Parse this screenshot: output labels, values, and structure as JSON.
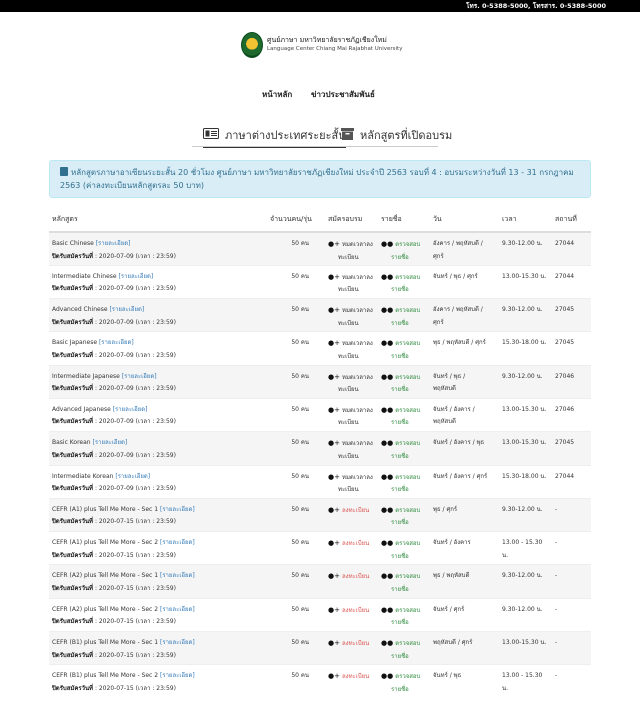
{
  "topbar": {
    "phones": "โทร. 0-5388-5000, โทรสาร. 0-5388-5000"
  },
  "logo": {
    "th": "ศูนย์ภาษา มหาวิทยาลัยราชภัฏเชียงใหม่",
    "en": "Language Center Chiang Mai Rajabhat University"
  },
  "nav": {
    "home": "หน้าหลัก",
    "news": "ข่าวประชาสัมพันธ์"
  },
  "tabs": {
    "short_courses": "ภาษาต่างประเทศระยะสั้น",
    "open_courses": "หลักสูตรที่เปิดอบรม"
  },
  "info": {
    "text": "หลักสูตรภาษาอาเซียนระยะสั้น 20 ชั่วโมง ศูนย์ภาษา มหาวิทยาลัยราชภัฏเชียงใหม่ ประจำปี 2563 รอบที่ 4 : อบรมระหว่างวันที่ 13 - 31 กรกฎาคม 2563 (ค่าลงทะเบียนหลักสูตรละ 50 บาท)"
  },
  "table": {
    "headers": {
      "course": "หลักสูตร",
      "quota": "จำนวนคน/รุ่น",
      "apply": "สมัครอบรม",
      "list": "รายชื่อ",
      "day": "วัน",
      "time": "เวลา",
      "room": "สถานที่"
    },
    "detail_label": "[รายละเอียด]",
    "close_label": "ปิดรับสมัครวันที่",
    "check_label": "ตรวจสอบ",
    "list_label": "รายชื่อ",
    "rows": [
      {
        "name": "Basic Chinese",
        "close": ": 2020-07-09 (เวลา : 23:59)",
        "quota": "50 คน",
        "reg1": "หมดเวลาลง",
        "reg2": "ทะเบียน",
        "day1": "อังคาร / พฤหัสบดี /",
        "day2": "ศุกร์",
        "time": "9.30-12.00 น.",
        "room": "27044"
      },
      {
        "name": "Intermediate Chinese",
        "close": ": 2020-07-09 (เวลา : 23:59)",
        "quota": "50 คน",
        "reg1": "หมดเวลาลง",
        "reg2": "ทะเบียน",
        "day1": "จันทร์ / พุธ / ศุกร์",
        "day2": "",
        "time": "13.00-15.30 น.",
        "room": "27044"
      },
      {
        "name": "Advanced Chinese",
        "close": ": 2020-07-09 (เวลา : 23:59)",
        "quota": "50 คน",
        "reg1": "หมดเวลาลง",
        "reg2": "ทะเบียน",
        "day1": "อังคาร / พฤหัสบดี /",
        "day2": "ศุกร์",
        "time": "9.30-12.00 น.",
        "room": "27045"
      },
      {
        "name": "Basic Japanese",
        "close": ": 2020-07-09 (เวลา : 23:59)",
        "quota": "50 คน",
        "reg1": "หมดเวลาลง",
        "reg2": "ทะเบียน",
        "day1": "พุธ / พฤหัสบดี / ศุกร์",
        "day2": "",
        "time": "15.30-18.00 น.",
        "room": "27045"
      },
      {
        "name": "Intermediate Japanese",
        "close": ": 2020-07-09 (เวลา : 23:59)",
        "quota": "50 คน",
        "reg1": "หมดเวลาลง",
        "reg2": "ทะเบียน",
        "day1": "จันทร์ / พุธ /",
        "day2": "พฤหัสบดี",
        "time": "9.30-12.00 น.",
        "room": "27046"
      },
      {
        "name": "Advanced Japanese",
        "close": ": 2020-07-09 (เวลา : 23:59)",
        "quota": "50 คน",
        "reg1": "หมดเวลาลง",
        "reg2": "ทะเบียน",
        "day1": "จันทร์ / อังคาร /",
        "day2": "พฤหัสบดี",
        "time": "13.00-15.30 น.",
        "room": "27046"
      },
      {
        "name": "Basic Korean",
        "close": ": 2020-07-09 (เวลา : 23:59)",
        "quota": "50 คน",
        "reg1": "หมดเวลาลง",
        "reg2": "ทะเบียน",
        "day1": "จันทร์ / อังคาร / พุธ",
        "day2": "",
        "time": "13.00-15.30 น.",
        "room": "27045"
      },
      {
        "name": "Intermediate Korean",
        "close": ": 2020-07-09 (เวลา : 23:59)",
        "quota": "50 คน",
        "reg1": "หมดเวลาลง",
        "reg2": "ทะเบียน",
        "day1": "จันทร์ / อังคาร / ศุกร์",
        "day2": "",
        "time": "15.30-18.00 น.",
        "room": "27044"
      },
      {
        "name": "CEFR (A1) plus Tell Me More - Sec 1",
        "close": ": 2020-07-15 (เวลา : 23:59)",
        "quota": "50 คน",
        "reg1": "ลงทะเบียน",
        "reg2": "",
        "day1": "พุธ / ศุกร์",
        "day2": "",
        "time": "9.30-12.00 น.",
        "room": "-"
      },
      {
        "name": "CEFR (A1) plus Tell Me More - Sec 2",
        "close": ": 2020-07-15 (เวลา : 23:59)",
        "quota": "50 คน",
        "reg1": "ลงทะเบียน",
        "reg2": "",
        "day1": "จันทร์ / อังคาร",
        "day2": "",
        "time": "13.00 - 15.30 น.",
        "room": "-"
      },
      {
        "name": "CEFR (A2) plus Tell Me More - Sec 1",
        "close": ": 2020-07-15 (เวลา : 23:59)",
        "quota": "50 คน",
        "reg1": "ลงทะเบียน",
        "reg2": "",
        "day1": "พุธ / พฤหัสบดี",
        "day2": "",
        "time": "9.30-12.00 น.",
        "room": "-"
      },
      {
        "name": "CEFR (A2) plus Tell Me More - Sec 2",
        "close": ": 2020-07-15 (เวลา : 23:59)",
        "quota": "50 คน",
        "reg1": "ลงทะเบียน",
        "reg2": "",
        "day1": "จันทร์ / ศุกร์",
        "day2": "",
        "time": "9.30-12.00 น.",
        "room": "-"
      },
      {
        "name": "CEFR (B1) plus Tell Me More - Sec 1",
        "close": ": 2020-07-15 (เวลา : 23:59)",
        "quota": "50 คน",
        "reg1": "ลงทะเบียน",
        "reg2": "",
        "day1": "พฤหัสบดี / ศุกร์",
        "day2": "",
        "time": "13.00-15.30 น.",
        "room": "-"
      },
      {
        "name": "CEFR (B1) plus Tell Me More - Sec 2",
        "close": ": 2020-07-15 (เวลา : 23:59)",
        "quota": "50 คน",
        "reg1": "ลงทะเบียน",
        "reg2": "",
        "day1": "จันทร์ / พุธ",
        "day2": "",
        "time": "13.00 - 15.30 น.",
        "room": "-"
      }
    ]
  }
}
